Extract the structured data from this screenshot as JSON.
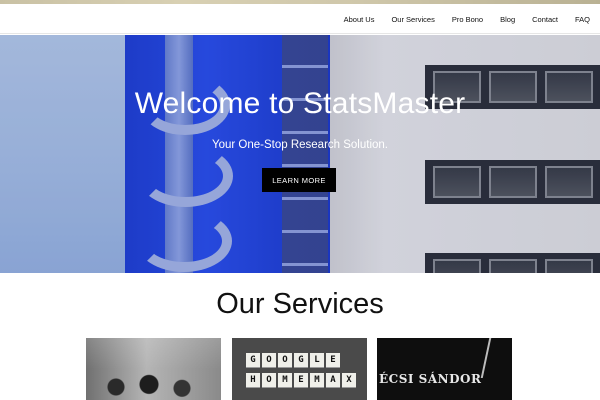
{
  "nav": {
    "items": [
      {
        "label": "About Us"
      },
      {
        "label": "Our Services"
      },
      {
        "label": "Pro Bono"
      },
      {
        "label": "Blog"
      },
      {
        "label": "Contact"
      },
      {
        "label": "FAQ"
      }
    ]
  },
  "hero": {
    "title": "Welcome to StatsMaster",
    "subtitle": "Your One-Stop Research Solution.",
    "button_label": "LEARN MORE"
  },
  "services": {
    "title": "Our Services",
    "cards": [
      {
        "image": "group-meeting-photo"
      },
      {
        "image": "letter-tiles-photo",
        "tiles_row1": [
          "G",
          "O",
          "O",
          "G",
          "L",
          "E"
        ],
        "tiles_row2": [
          "H",
          "O",
          "M",
          "E",
          "M",
          "A",
          "X"
        ]
      },
      {
        "image": "street-sign-photo",
        "sign_text": "ÉCSI SÁNDOR"
      }
    ]
  },
  "colors": {
    "button_bg": "#000000",
    "nav_text": "#111111",
    "hero_blue": "#2a4ff0"
  }
}
